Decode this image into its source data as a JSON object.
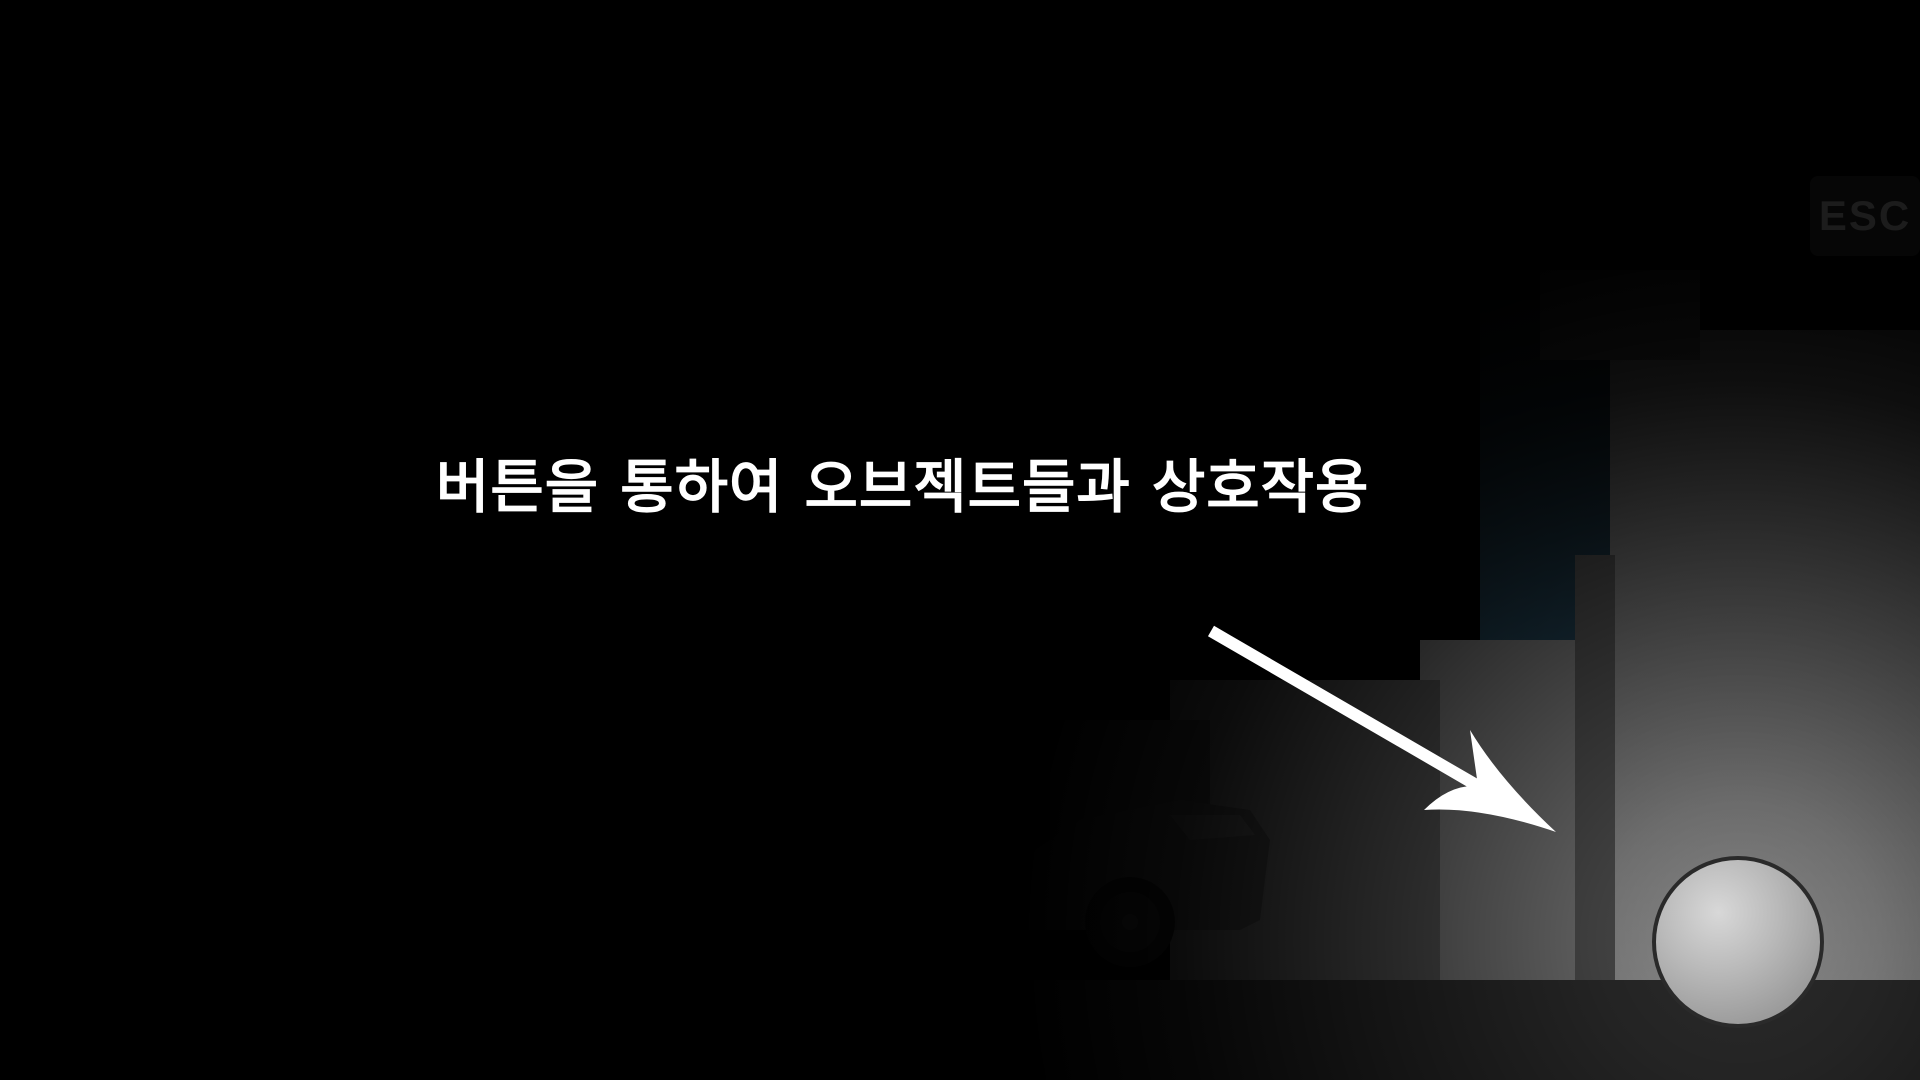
{
  "tutorial": {
    "message": "버튼을 통하여 오브젝트들과 상호작용"
  },
  "controls": {
    "esc_label": "ESC",
    "action_button_icon": "circle-button"
  },
  "colors": {
    "background": "#000000",
    "text": "#ffffff",
    "arrow": "#ffffff",
    "action_button": "#b9b9b9",
    "night_sky_accent": "#1e3a4a"
  },
  "icons": {
    "arrow": "arrow-down-right-icon",
    "car": "car-sprite"
  }
}
